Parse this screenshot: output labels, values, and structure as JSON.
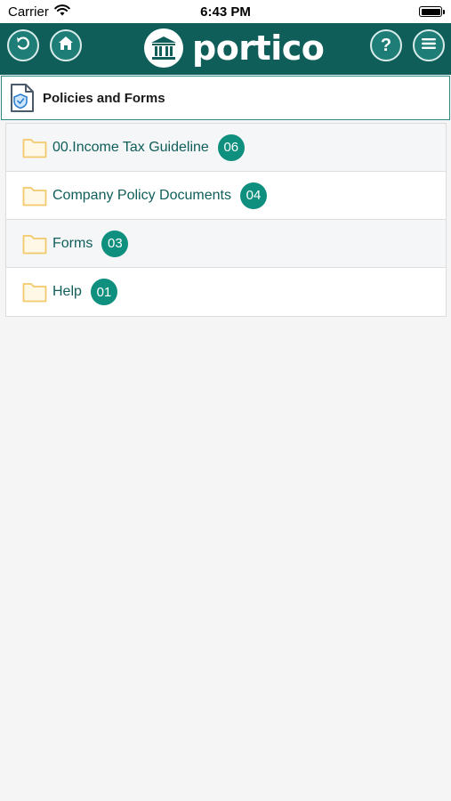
{
  "status_bar": {
    "carrier": "Carrier",
    "time": "6:43 PM"
  },
  "header": {
    "app_name": "portico",
    "help_label": "?",
    "icons": {
      "back": "back-arrow-icon",
      "home": "home-icon",
      "help": "help-icon",
      "menu": "hamburger-menu-icon",
      "logo": "bank-building-icon"
    }
  },
  "page": {
    "title": "Policies and Forms",
    "title_icon": "document-shield-icon"
  },
  "folders": [
    {
      "label": "00.Income Tax Guideline",
      "count": "06",
      "icon": "folder-icon"
    },
    {
      "label": "Company Policy Documents",
      "count": "04",
      "icon": "folder-icon"
    },
    {
      "label": "Forms",
      "count": "03",
      "icon": "folder-icon"
    },
    {
      "label": "Help",
      "count": "01",
      "icon": "folder-icon"
    }
  ],
  "colors": {
    "header_bg": "#0f5e5a",
    "accent": "#0f8f7e",
    "folder": "#f3c96b",
    "text_link": "#0f5e5a"
  }
}
